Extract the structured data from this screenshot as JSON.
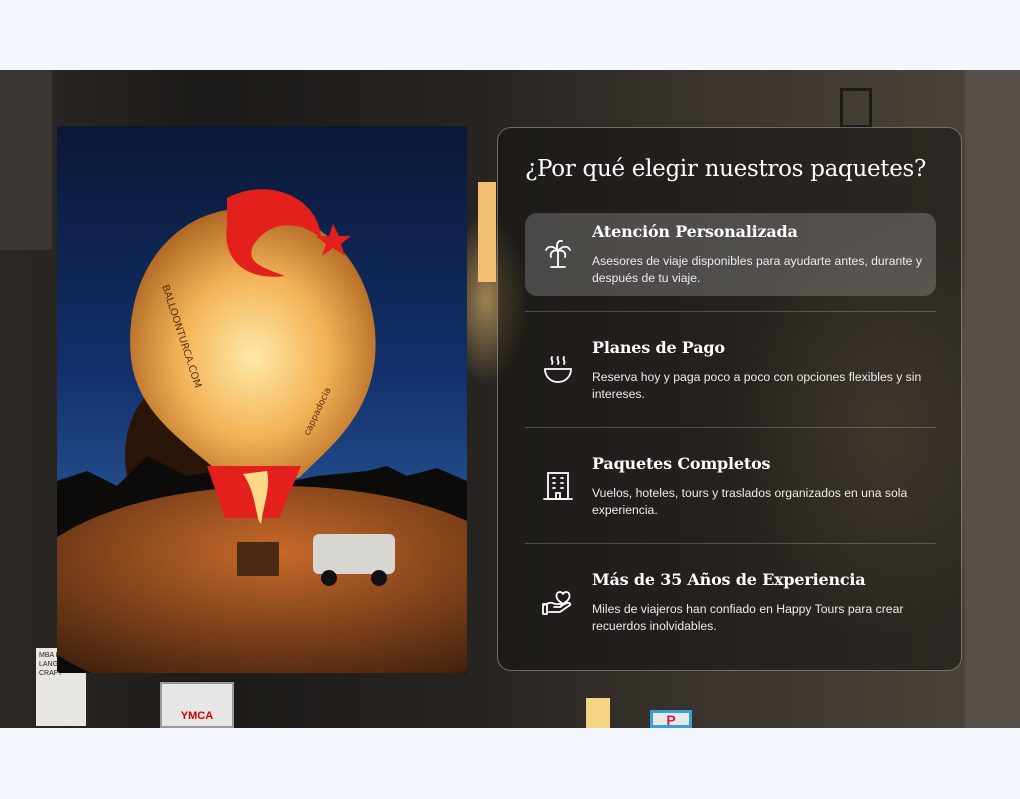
{
  "section": {
    "title": "¿Por qué elegir nuestros paquetes?",
    "features": [
      {
        "icon": "palm-tree-icon",
        "title": "Atención Personalizada",
        "text": "Asesores de viaje disponibles para ayudarte antes, durante y después de tu viaje.",
        "active": true
      },
      {
        "icon": "bowl-icon",
        "title": "Planes de Pago",
        "text": "Reserva hoy y paga poco a poco con opciones flexibles y sin intereses."
      },
      {
        "icon": "building-icon",
        "title": "Paquetes Completos",
        "text": "Vuelos, hoteles, tours y traslados organizados en una sola experiencia."
      },
      {
        "icon": "hand-heart-icon",
        "title": "Más de 35 Años de Experiencia",
        "text": "Miles de viajeros han confiado en Happy Tours para crear recuerdos inolvidables."
      }
    ]
  },
  "image": {
    "alt": "Hot air balloon at night",
    "balloon_text": "BALLOONTURCA.COM",
    "balloon_text_2": "cappadocia"
  },
  "background_signs": {
    "left_sign": "MBA HER LANGS & CRAFT",
    "ymca": "YMCA",
    "parking": "P"
  },
  "colors": {
    "page_bg": "#f3f6fc",
    "panel_bg": "rgba(20,18,16,0.55)",
    "text": "#ffffff",
    "balloon_red": "#e3201c"
  }
}
